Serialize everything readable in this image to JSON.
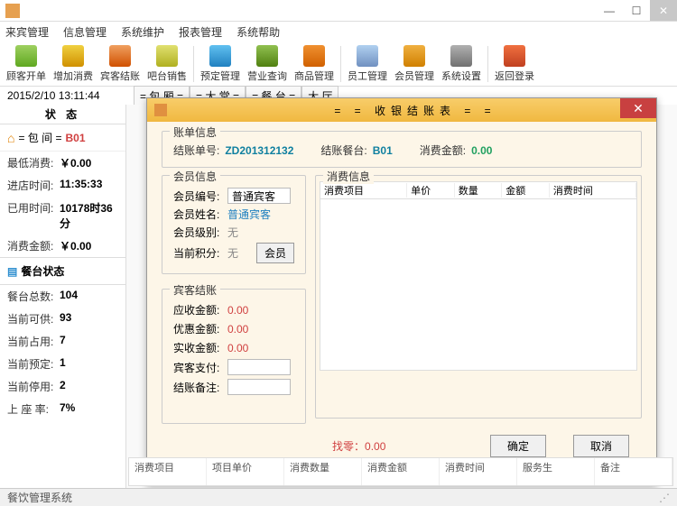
{
  "window": {
    "timestamp": "2015/2/10 13:11:44"
  },
  "menu": [
    "来宾管理",
    "信息管理",
    "系统维护",
    "报表管理",
    "系统帮助"
  ],
  "toolbar": [
    {
      "label": "顾客开单"
    },
    {
      "label": "增加消费"
    },
    {
      "label": "宾客结账"
    },
    {
      "label": "吧台销售"
    },
    {
      "label": "预定管理"
    },
    {
      "label": "营业查询"
    },
    {
      "label": "商品管理"
    },
    {
      "label": "员工管理"
    },
    {
      "label": "会员管理"
    },
    {
      "label": "系统设置"
    },
    {
      "label": "返回登录"
    }
  ],
  "view_tabs": [
    "= 包 厢 =",
    "= 大 堂 =",
    "= 餐 台 =",
    "大 厅"
  ],
  "sidebar": {
    "header": "状 态",
    "room_label": "= 包 间 =",
    "room_no": "B01",
    "rows1": [
      {
        "k": "最低消费:",
        "v": "￥0.00"
      },
      {
        "k": "进店时间:",
        "v": "11:35:33"
      },
      {
        "k": "已用时间:",
        "v": "10178时36分"
      },
      {
        "k": "消费金额:",
        "v": "￥0.00"
      }
    ],
    "table_state": "餐台状态",
    "rows2": [
      {
        "k": "餐台总数:",
        "v": "104"
      },
      {
        "k": "当前可供:",
        "v": "93"
      },
      {
        "k": "当前占用:",
        "v": "7"
      },
      {
        "k": "当前预定:",
        "v": "1"
      },
      {
        "k": "当前停用:",
        "v": "2"
      },
      {
        "k": "上 座 率:",
        "v": "7%"
      }
    ]
  },
  "dialog": {
    "title": "= = 收银结账表 = =",
    "bill": {
      "legend": "账单信息",
      "no_l": "结账单号:",
      "no_v": "ZD201312132",
      "table_l": "结账餐台:",
      "table_v": "B01",
      "amt_l": "消费金额:",
      "amt_v": "0.00"
    },
    "member": {
      "legend": "会员信息",
      "id_l": "会员编号:",
      "id_v": "普通宾客",
      "name_l": "会员姓名:",
      "name_v": "普通宾客",
      "level_l": "会员级别:",
      "level_v": "无",
      "pts_l": "当前积分:",
      "pts_v": "无",
      "btn": "会员"
    },
    "consume": {
      "legend": "消费信息",
      "cols": [
        "消费项目",
        "单价",
        "数量",
        "金额",
        "消费时间"
      ]
    },
    "settle": {
      "legend": "宾客结账",
      "due_l": "应收金额:",
      "due_v": "0.00",
      "disc_l": "优惠金额:",
      "disc_v": "0.00",
      "real_l": "实收金额:",
      "real_v": "0.00",
      "pay_l": "宾客支付:",
      "note_l": "结账备注:"
    },
    "change_l": "找零：",
    "change_v": "0.00",
    "ok": "确定",
    "cancel": "取消"
  },
  "bottom_cols": [
    "消费项目",
    "项目单价",
    "消费数量",
    "消费金额",
    "消费时间",
    "服务生",
    "备注"
  ],
  "status": "餐饮管理系统"
}
